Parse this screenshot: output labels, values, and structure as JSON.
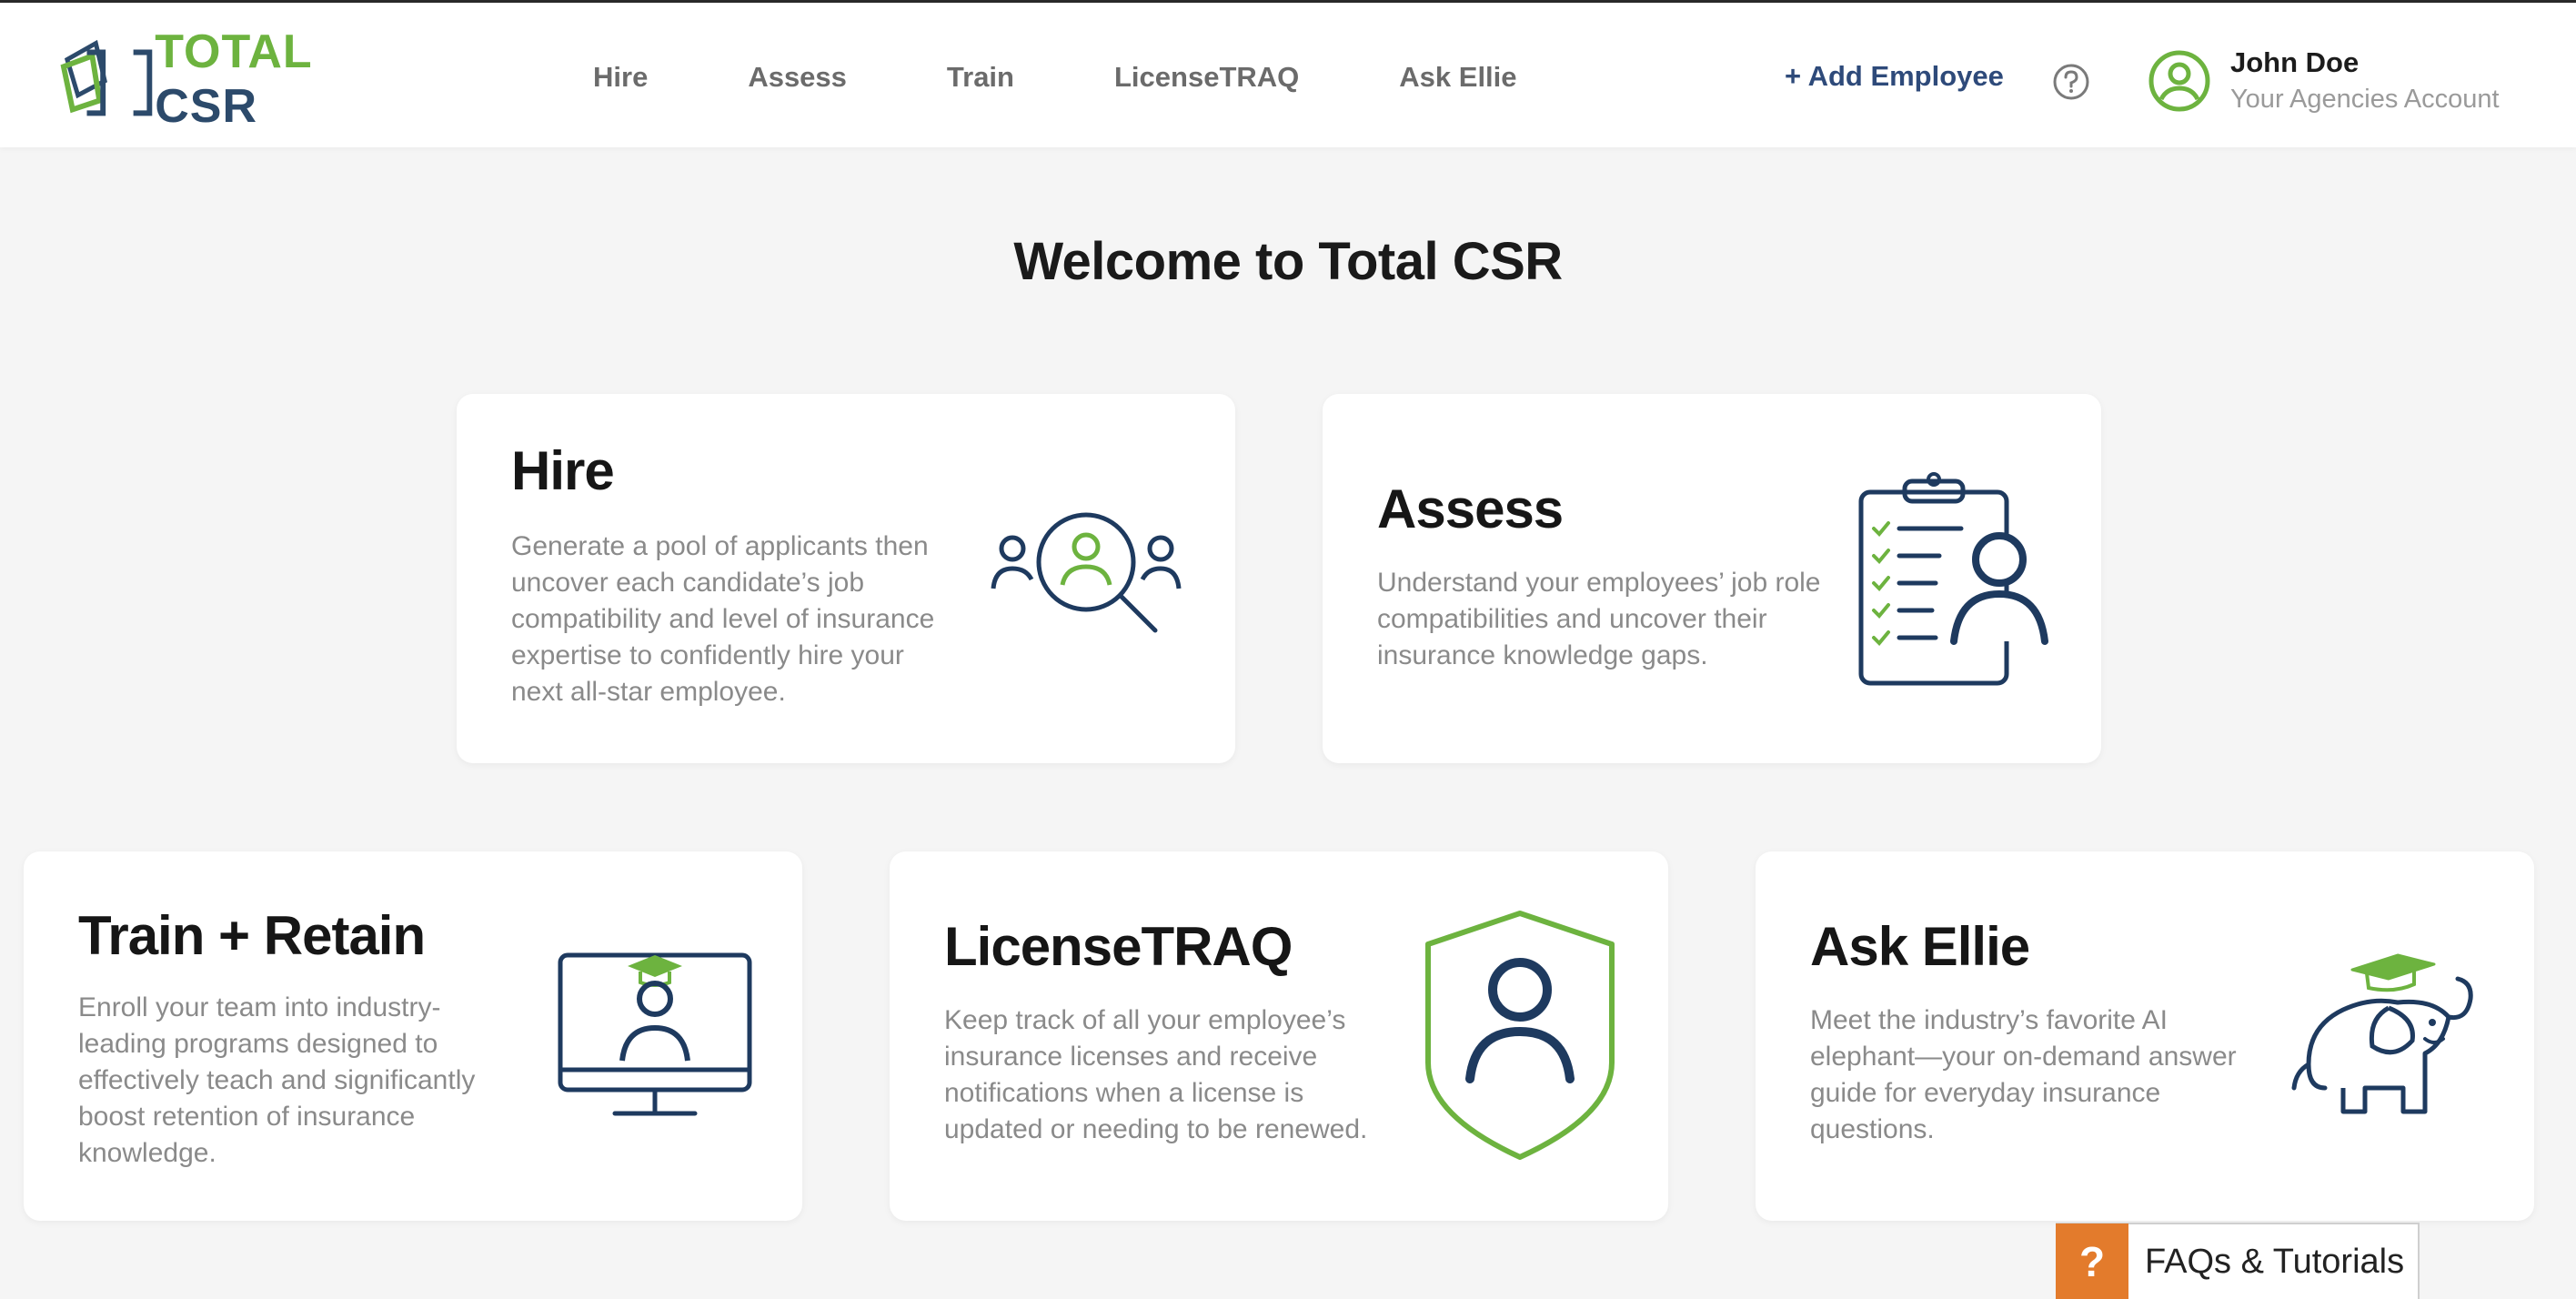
{
  "header": {
    "logo": {
      "word1": "TOTAL",
      "word2": "CSR"
    },
    "nav": [
      {
        "label": "Hire"
      },
      {
        "label": "Assess"
      },
      {
        "label": "Train"
      },
      {
        "label": "LicenseTRAQ"
      },
      {
        "label": "Ask Ellie"
      }
    ],
    "add_employee": "+ Add Employee",
    "help_icon": "question-circle-icon",
    "user": {
      "name": "John Doe",
      "account": "Your Agencies Account",
      "avatar_icon": "user-circle-icon"
    }
  },
  "main": {
    "title": "Welcome to Total CSR",
    "cards": [
      {
        "title": "Hire",
        "description": "Generate a pool of applicants then uncover each candidate’s job compatibility and level of insurance expertise to confidently hire your next all-star employee.",
        "icon": "candidate-search-icon"
      },
      {
        "title": "Assess",
        "description": "Understand your employees’ job role compatibilities and uncover their insurance knowledge gaps.",
        "icon": "clipboard-user-icon"
      },
      {
        "title": "Train + Retain",
        "description": "Enroll your team into industry-leading programs designed to effectively teach and significantly boost retention of insurance knowledge.",
        "icon": "monitor-graduate-icon"
      },
      {
        "title": "LicenseTRAQ",
        "description": "Keep track of all your employee’s insurance licenses and receive notifications when a license is updated or needing to be renewed.",
        "icon": "shield-user-icon"
      },
      {
        "title": "Ask Ellie",
        "description": "Meet the industry’s favorite AI elephant—your on-demand answer guide for everyday insurance questions.",
        "icon": "elephant-graduate-icon"
      }
    ]
  },
  "faq": {
    "icon_glyph": "?",
    "label": "FAQs & Tutorials"
  },
  "colors": {
    "green": "#6db33f",
    "navy": "#1e3a5f",
    "link": "#2e4a7a",
    "faq_orange": "#e37b2c"
  }
}
